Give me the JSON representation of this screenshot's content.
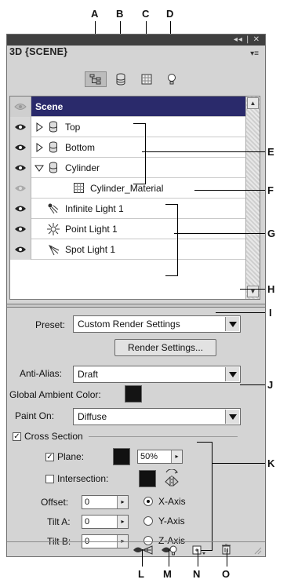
{
  "callouts": {
    "a": "A",
    "b": "B",
    "c": "C",
    "d": "D",
    "e": "E",
    "f": "F",
    "g": "G",
    "h": "H",
    "i": "I",
    "j": "J",
    "k": "K",
    "l": "L",
    "m": "M",
    "n": "N",
    "o": "O"
  },
  "panel": {
    "tab_title": "3D {SCENE}",
    "titlebar_controls": "◂◂ | ✕",
    "menu_icon": "▾≡"
  },
  "modes": [
    {
      "icon": "scene-icon",
      "active": true
    },
    {
      "icon": "mesh-icon",
      "active": false
    },
    {
      "icon": "materials-icon",
      "active": false
    },
    {
      "icon": "lights-icon",
      "active": false
    }
  ],
  "scene_list": {
    "header": "Scene",
    "items": [
      {
        "label": "Top",
        "icon": "mesh-icon",
        "toggle": "collapsed"
      },
      {
        "label": "Bottom",
        "icon": "mesh-icon",
        "toggle": "collapsed"
      },
      {
        "label": "Cylinder",
        "icon": "mesh-icon",
        "toggle": "expanded"
      },
      {
        "label": "Cylinder_Material",
        "icon": "material-icon",
        "toggle": "none"
      },
      {
        "label": "Infinite Light 1",
        "icon": "infinite-light-icon",
        "toggle": "none"
      },
      {
        "label": "Point Light 1",
        "icon": "point-light-icon",
        "toggle": "none"
      },
      {
        "label": "Spot Light 1",
        "icon": "spot-light-icon",
        "toggle": "none"
      }
    ]
  },
  "render": {
    "preset_label": "Preset:",
    "preset_value": "Custom Render Settings",
    "render_settings_button": "Render Settings...",
    "anti_alias_label": "Anti-Alias:",
    "anti_alias_value": "Draft",
    "ambient_label": "Global Ambient Color:",
    "ambient_color": "#141414",
    "paint_on_label": "Paint On:",
    "paint_on_value": "Diffuse"
  },
  "cross_section": {
    "label": "Cross Section",
    "checked": true,
    "plane_label": "Plane:",
    "plane_checked": true,
    "plane_opacity": "50%",
    "intersection_label": "Intersection:",
    "intersection_checked": false,
    "offset_label": "Offset:",
    "offset_value": "0",
    "tilt_a_label": "Tilt A:",
    "tilt_a_value": "0",
    "tilt_b_label": "Tilt B:",
    "tilt_b_value": "0",
    "axes": [
      {
        "label": "X-Axis",
        "selected": true
      },
      {
        "label": "Y-Axis",
        "selected": false
      },
      {
        "label": "Z-Axis",
        "selected": false
      }
    ]
  },
  "bottom_icons": [
    "ground-plane-icon",
    "light-guides-icon",
    "new-light-icon",
    "delete-icon"
  ]
}
